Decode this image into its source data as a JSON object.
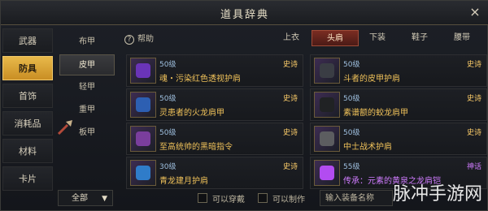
{
  "window": {
    "title": "道具辞典",
    "close_icon": "×"
  },
  "left_categories": [
    "武器",
    "防具",
    "首饰",
    "消耗品",
    "材料",
    "卡片"
  ],
  "active_category_index": 1,
  "armor_types": [
    "布甲",
    "皮甲",
    "轻甲",
    "重甲",
    "板甲"
  ],
  "active_armor_index": 1,
  "help_label": "帮助",
  "slot_tabs": [
    "上衣",
    "头肩",
    "下装",
    "鞋子",
    "腰带"
  ],
  "active_slot_index": 1,
  "items": [
    {
      "level": "50级",
      "rarity": "史诗",
      "name": "魂・污染红色透视护肩",
      "rarity_color": "gold",
      "icon": "purple-cloth-icon"
    },
    {
      "level": "50级",
      "rarity": "史诗",
      "name": "斗者的皮甲护肩",
      "rarity_color": "gold",
      "icon": "dark-pauldron-icon"
    },
    {
      "level": "50级",
      "rarity": "史诗",
      "name": "灵患者的火龙肩甲",
      "rarity_color": "gold",
      "icon": "blue-pauldron-icon"
    },
    {
      "level": "50级",
      "rarity": "史诗",
      "name": "素谱额的蛟龙肩甲",
      "rarity_color": "gold",
      "icon": "black-pauldron-icon"
    },
    {
      "level": "50级",
      "rarity": "史诗",
      "name": "至高统帅的黑暗指令",
      "rarity_color": "gold",
      "icon": "violet-feather-icon"
    },
    {
      "level": "50级",
      "rarity": "史诗",
      "name": "中士战术护肩",
      "rarity_color": "gold",
      "icon": "grey-pauldron-icon"
    },
    {
      "level": "30级",
      "rarity": "史诗",
      "name": "青龙建月护肩",
      "rarity_color": "gold",
      "icon": "azure-pauldron-icon"
    },
    {
      "level": "55级",
      "rarity": "神话",
      "name": "传承：元素的黄泉之龙肩铠",
      "rarity_color": "purple",
      "icon": "purple-mythic-icon"
    }
  ],
  "filter": {
    "selected": "全部",
    "options_icon": "chevron-down-icon"
  },
  "checkbox_labels": [
    "可以穿戴",
    "可以制作"
  ],
  "search_placeholder": "输入装备名称",
  "watermark": "脉冲手游网",
  "colors": {
    "accent": "#e8b94a",
    "epic": "#ffcf6a",
    "mythic": "#d07cff"
  }
}
